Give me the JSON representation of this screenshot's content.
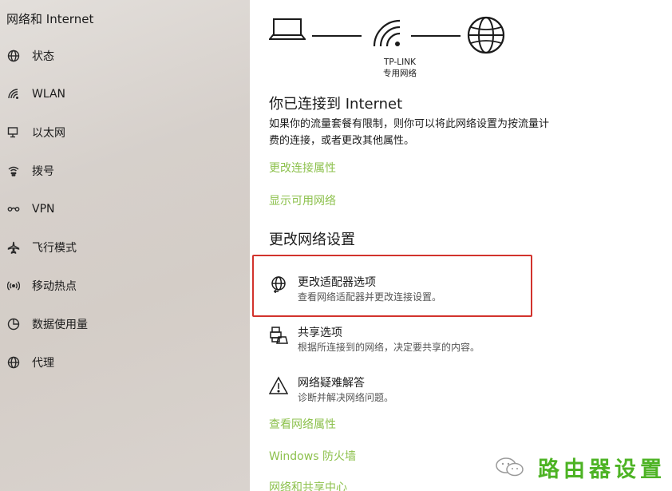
{
  "sidebar": {
    "title": "网络和 Internet",
    "items": [
      {
        "label": "状态",
        "icon": "status-globe-icon"
      },
      {
        "label": "WLAN",
        "icon": "wifi-icon"
      },
      {
        "label": "以太网",
        "icon": "ethernet-icon"
      },
      {
        "label": "拨号",
        "icon": "dialup-icon"
      },
      {
        "label": "VPN",
        "icon": "vpn-icon"
      },
      {
        "label": "飞行模式",
        "icon": "airplane-icon"
      },
      {
        "label": "移动热点",
        "icon": "hotspot-icon"
      },
      {
        "label": "数据使用量",
        "icon": "data-usage-icon"
      },
      {
        "label": "代理",
        "icon": "proxy-globe-icon"
      }
    ]
  },
  "status": {
    "network_name": "TP-LINK",
    "network_type": "专用网络",
    "heading": "你已连接到 Internet",
    "description_line1": "如果你的流量套餐有限制，则你可以将此网络设置为按流量计",
    "description_line2": "费的连接，或者更改其他属性。",
    "links": {
      "change_props": "更改连接属性",
      "show_networks": "显示可用网络"
    }
  },
  "change_settings": {
    "heading": "更改网络设置",
    "options": [
      {
        "title": "更改适配器选项",
        "subtitle": "查看网络适配器并更改连接设置。",
        "icon": "adapter-globe-icon"
      },
      {
        "title": "共享选项",
        "subtitle": "根据所连接到的网络，决定要共享的内容。",
        "icon": "sharing-icon"
      },
      {
        "title": "网络疑难解答",
        "subtitle": "诊断并解决网络问题。",
        "icon": "warning-icon"
      }
    ]
  },
  "footer_links": {
    "view_props": "查看网络属性",
    "firewall": "Windows 防火墙",
    "network_center": "网络和共享中心"
  },
  "watermark": {
    "text": "路由器设置"
  },
  "colors": {
    "link": "#8dc14d",
    "highlight": "#d2332d",
    "watermark": "#4db324"
  }
}
